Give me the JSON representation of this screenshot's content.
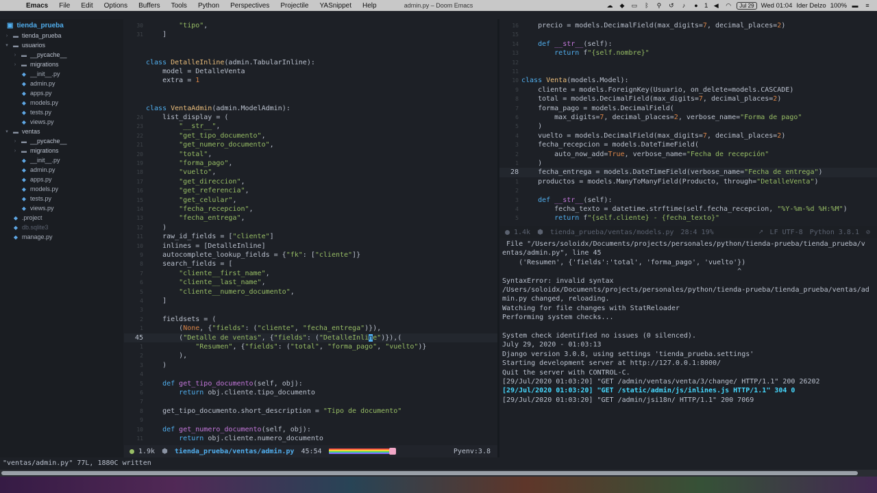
{
  "menubar": {
    "app": "Emacs",
    "items": [
      "File",
      "Edit",
      "Options",
      "Buffers",
      "Tools",
      "Python",
      "Perspectives",
      "Projectile",
      "YASnippet",
      "Help"
    ],
    "window_title": "admin.py – Doom Emacs",
    "date_badge": "Jul 29",
    "clock": "Wed 01:04",
    "user": "Ider Delzo",
    "battery": "100%",
    "notif_count": "1"
  },
  "sidebar": {
    "root": "tienda_prueba",
    "items": [
      {
        "label": "tienda_prueba",
        "kind": "dir",
        "open": false,
        "indent": 1
      },
      {
        "label": "usuarios",
        "kind": "dir",
        "open": true,
        "indent": 1
      },
      {
        "label": "__pycache__",
        "kind": "dir",
        "open": false,
        "indent": 2
      },
      {
        "label": "migrations",
        "kind": "dir",
        "open": false,
        "indent": 2
      },
      {
        "label": "__init__.py",
        "kind": "file",
        "indent": 2
      },
      {
        "label": "admin.py",
        "kind": "file",
        "indent": 2
      },
      {
        "label": "apps.py",
        "kind": "file",
        "indent": 2
      },
      {
        "label": "models.py",
        "kind": "file",
        "indent": 2
      },
      {
        "label": "tests.py",
        "kind": "file",
        "indent": 2
      },
      {
        "label": "views.py",
        "kind": "file",
        "indent": 2
      },
      {
        "label": "ventas",
        "kind": "dir",
        "open": true,
        "indent": 1
      },
      {
        "label": "__pycache__",
        "kind": "dir",
        "open": false,
        "indent": 2
      },
      {
        "label": "migrations",
        "kind": "dir",
        "open": false,
        "indent": 2
      },
      {
        "label": "__init__.py",
        "kind": "file",
        "indent": 2
      },
      {
        "label": "admin.py",
        "kind": "file",
        "indent": 2
      },
      {
        "label": "apps.py",
        "kind": "file",
        "indent": 2
      },
      {
        "label": "models.py",
        "kind": "file",
        "indent": 2
      },
      {
        "label": "tests.py",
        "kind": "file",
        "indent": 2
      },
      {
        "label": "views.py",
        "kind": "file",
        "indent": 2
      },
      {
        "label": ".project",
        "kind": "file",
        "indent": 1
      },
      {
        "label": "db.sqlite3",
        "kind": "file",
        "indent": 1,
        "dim": true
      },
      {
        "label": "manage.py",
        "kind": "file",
        "indent": 1
      }
    ]
  },
  "left_editor": {
    "lines": [
      {
        "n": "30",
        "t": [
          [
            "str",
            "        \"tipo\""
          ],
          [
            "pl",
            ","
          ]
        ]
      },
      {
        "n": "31",
        "t": [
          [
            "pl",
            "    ]"
          ]
        ]
      },
      {
        "n": "",
        "t": []
      },
      {
        "n": "",
        "t": []
      },
      {
        "n": "",
        "t": [
          [
            "kw",
            "class "
          ],
          [
            "cls",
            "DetalleInline"
          ],
          [
            "pl",
            "(admin.TabularInline):"
          ]
        ]
      },
      {
        "n": "",
        "t": [
          [
            "pl",
            "    model = DetalleVenta"
          ]
        ]
      },
      {
        "n": "",
        "t": [
          [
            "pl",
            "    extra = "
          ],
          [
            "num",
            "1"
          ]
        ]
      },
      {
        "n": "",
        "t": []
      },
      {
        "n": "",
        "t": []
      },
      {
        "n": "",
        "t": [
          [
            "kw",
            "class "
          ],
          [
            "cls",
            "VentaAdmin"
          ],
          [
            "pl",
            "(admin.ModelAdmin):"
          ]
        ]
      },
      {
        "n": "24",
        "t": [
          [
            "pl",
            "    list_display = ("
          ]
        ]
      },
      {
        "n": "23",
        "t": [
          [
            "str",
            "        \"__str__\""
          ],
          [
            "pl",
            ","
          ]
        ]
      },
      {
        "n": "22",
        "t": [
          [
            "str",
            "        \"get_tipo_documento\""
          ],
          [
            "pl",
            ","
          ]
        ]
      },
      {
        "n": "21",
        "t": [
          [
            "str",
            "        \"get_numero_documento\""
          ],
          [
            "pl",
            ","
          ]
        ]
      },
      {
        "n": "20",
        "t": [
          [
            "str",
            "        \"total\""
          ],
          [
            "pl",
            ","
          ]
        ]
      },
      {
        "n": "19",
        "t": [
          [
            "str",
            "        \"forma_pago\""
          ],
          [
            "pl",
            ","
          ]
        ]
      },
      {
        "n": "18",
        "t": [
          [
            "str",
            "        \"vuelto\""
          ],
          [
            "pl",
            ","
          ]
        ]
      },
      {
        "n": "17",
        "t": [
          [
            "str",
            "        \"get_direccion\""
          ],
          [
            "pl",
            ","
          ]
        ]
      },
      {
        "n": "16",
        "t": [
          [
            "str",
            "        \"get_referencia\""
          ],
          [
            "pl",
            ","
          ]
        ]
      },
      {
        "n": "15",
        "t": [
          [
            "str",
            "        \"get_celular\""
          ],
          [
            "pl",
            ","
          ]
        ]
      },
      {
        "n": "14",
        "t": [
          [
            "str",
            "        \"fecha_recepcion\""
          ],
          [
            "pl",
            ","
          ]
        ]
      },
      {
        "n": "13",
        "t": [
          [
            "str",
            "        \"fecha_entrega\""
          ],
          [
            "pl",
            ","
          ]
        ]
      },
      {
        "n": "12",
        "t": [
          [
            "pl",
            "    )"
          ]
        ]
      },
      {
        "n": "11",
        "t": [
          [
            "pl",
            "    raw_id_fields = ["
          ],
          [
            "str",
            "\"cliente\""
          ],
          [
            "pl",
            "]"
          ]
        ]
      },
      {
        "n": "10",
        "t": [
          [
            "pl",
            "    inlines = [DetalleInline]"
          ]
        ]
      },
      {
        "n": "9",
        "t": [
          [
            "pl",
            "    autocomplete_lookup_fields = {"
          ],
          [
            "str",
            "\"fk\""
          ],
          [
            "pl",
            ": ["
          ],
          [
            "str",
            "\"cliente\""
          ],
          [
            "pl",
            "]}"
          ]
        ]
      },
      {
        "n": "8",
        "t": [
          [
            "pl",
            "    search_fields = ["
          ]
        ]
      },
      {
        "n": "7",
        "t": [
          [
            "str",
            "        \"cliente__first_name\""
          ],
          [
            "pl",
            ","
          ]
        ]
      },
      {
        "n": "6",
        "t": [
          [
            "str",
            "        \"cliente__last_name\""
          ],
          [
            "pl",
            ","
          ]
        ]
      },
      {
        "n": "5",
        "t": [
          [
            "str",
            "        \"cliente__numero_documento\""
          ],
          [
            "pl",
            ","
          ]
        ]
      },
      {
        "n": "4",
        "t": [
          [
            "pl",
            "    ]"
          ]
        ]
      },
      {
        "n": "3",
        "t": []
      },
      {
        "n": "2",
        "t": [
          [
            "pl",
            "    fieldsets = ("
          ]
        ]
      },
      {
        "n": "1",
        "t": [
          [
            "pl",
            "        ("
          ],
          [
            "num",
            "None"
          ],
          [
            "pl",
            ", {"
          ],
          [
            "str",
            "\"fields\""
          ],
          [
            "pl",
            ": ("
          ],
          [
            "str",
            "\"cliente\""
          ],
          [
            "pl",
            ", "
          ],
          [
            "str",
            "\"fecha_entrega\""
          ],
          [
            "pl",
            ")}),"
          ]
        ]
      },
      {
        "n": "45",
        "cur": true,
        "t": [
          [
            "pl",
            "        ("
          ],
          [
            "str",
            "\"Detalle de ventas\""
          ],
          [
            "pl",
            ", {"
          ],
          [
            "str",
            "\"fields\""
          ],
          [
            "pl",
            ": ("
          ],
          [
            "str",
            "\"DetalleInli"
          ],
          [
            "cur",
            "n"
          ],
          [
            "str",
            "e\""
          ],
          [
            "pl",
            ")}),("
          ]
        ]
      },
      {
        "n": "1",
        "t": [
          [
            "str",
            "            \"Resumen\""
          ],
          [
            "pl",
            ", {"
          ],
          [
            "str",
            "\"fields\""
          ],
          [
            "pl",
            ": ("
          ],
          [
            "str",
            "\"total\""
          ],
          [
            "pl",
            ", "
          ],
          [
            "str",
            "\"forma_pago\""
          ],
          [
            "pl",
            ", "
          ],
          [
            "str",
            "\"vuelto\""
          ],
          [
            "pl",
            ")}"
          ]
        ]
      },
      {
        "n": "2",
        "t": [
          [
            "pl",
            "        ),"
          ]
        ]
      },
      {
        "n": "3",
        "t": [
          [
            "pl",
            "    )"
          ]
        ]
      },
      {
        "n": "4",
        "t": []
      },
      {
        "n": "5",
        "t": [
          [
            "kw",
            "    def "
          ],
          [
            "fn",
            "get_tipo_documento"
          ],
          [
            "pl",
            "(self, obj):"
          ]
        ]
      },
      {
        "n": "6",
        "t": [
          [
            "kw",
            "        return "
          ],
          [
            "pl",
            "obj.cliente.tipo_documento"
          ]
        ]
      },
      {
        "n": "7",
        "t": []
      },
      {
        "n": "8",
        "t": [
          [
            "pl",
            "    get_tipo_documento.short_description = "
          ],
          [
            "str",
            "\"Tipo de documento\""
          ]
        ]
      },
      {
        "n": "9",
        "t": []
      },
      {
        "n": "10",
        "t": [
          [
            "kw",
            "    def "
          ],
          [
            "fn",
            "get_numero_documento"
          ],
          [
            "pl",
            "(self, obj):"
          ]
        ]
      },
      {
        "n": "11",
        "t": [
          [
            "kw",
            "        return "
          ],
          [
            "pl",
            "obj.cliente.numero_documento"
          ]
        ]
      }
    ]
  },
  "right_editor": {
    "lines": [
      {
        "n": "16",
        "t": [
          [
            "pl",
            "    precio = models.DecimalField(max_digits="
          ],
          [
            "num",
            "7"
          ],
          [
            "pl",
            ", decimal_places="
          ],
          [
            "num",
            "2"
          ],
          [
            "pl",
            ")"
          ]
        ]
      },
      {
        "n": "15",
        "t": []
      },
      {
        "n": "14",
        "t": [
          [
            "kw",
            "    def "
          ],
          [
            "fn",
            "__str__"
          ],
          [
            "pl",
            "(self):"
          ]
        ]
      },
      {
        "n": "13",
        "t": [
          [
            "kw",
            "        return "
          ],
          [
            "pl",
            "f"
          ],
          [
            "str",
            "\"{self.nombre}\""
          ]
        ]
      },
      {
        "n": "12",
        "t": []
      },
      {
        "n": "11",
        "t": []
      },
      {
        "n": "10",
        "t": [
          [
            "kw",
            "class "
          ],
          [
            "cls",
            "Venta"
          ],
          [
            "pl",
            "(models.Model):"
          ]
        ]
      },
      {
        "n": "9",
        "t": [
          [
            "pl",
            "    cliente = models.ForeignKey(Usuario, on_delete=models.CASCADE)"
          ]
        ]
      },
      {
        "n": "8",
        "t": [
          [
            "pl",
            "    total = models.DecimalField(max_digits="
          ],
          [
            "num",
            "7"
          ],
          [
            "pl",
            ", decimal_places="
          ],
          [
            "num",
            "2"
          ],
          [
            "pl",
            ")"
          ]
        ]
      },
      {
        "n": "7",
        "t": [
          [
            "pl",
            "    forma_pago = models.DecimalField("
          ]
        ]
      },
      {
        "n": "6",
        "t": [
          [
            "pl",
            "        max_digits="
          ],
          [
            "num",
            "7"
          ],
          [
            "pl",
            ", decimal_places="
          ],
          [
            "num",
            "2"
          ],
          [
            "pl",
            ", verbose_name="
          ],
          [
            "str",
            "\"Forma de pago\""
          ]
        ]
      },
      {
        "n": "5",
        "t": [
          [
            "pl",
            "    )"
          ]
        ]
      },
      {
        "n": "4",
        "t": [
          [
            "pl",
            "    vuelto = models.DecimalField(max_digits="
          ],
          [
            "num",
            "7"
          ],
          [
            "pl",
            ", decimal_places="
          ],
          [
            "num",
            "2"
          ],
          [
            "pl",
            ")"
          ]
        ]
      },
      {
        "n": "3",
        "t": [
          [
            "pl",
            "    fecha_recepcion = models.DateTimeField("
          ]
        ]
      },
      {
        "n": "2",
        "t": [
          [
            "pl",
            "        auto_now_add="
          ],
          [
            "num",
            "True"
          ],
          [
            "pl",
            ", verbose_name="
          ],
          [
            "str",
            "\"Fecha de recepción\""
          ]
        ]
      },
      {
        "n": "1",
        "t": [
          [
            "pl",
            "    )"
          ]
        ]
      },
      {
        "n": "28",
        "cur": true,
        "t": [
          [
            "pl",
            "    fecha_entrega = models.DateTimeField(verbose_name="
          ],
          [
            "str",
            "\"Fecha de entrega\""
          ],
          [
            "pl",
            ")"
          ]
        ]
      },
      {
        "n": "1",
        "t": [
          [
            "pl",
            "    productos = models.ManyToManyField(Producto, through="
          ],
          [
            "str",
            "\"DetalleVenta\""
          ],
          [
            "pl",
            ")"
          ]
        ]
      },
      {
        "n": "2",
        "t": []
      },
      {
        "n": "3",
        "t": [
          [
            "kw",
            "    def "
          ],
          [
            "fn",
            "__str__"
          ],
          [
            "pl",
            "(self):"
          ]
        ]
      },
      {
        "n": "4",
        "t": [
          [
            "pl",
            "        fecha_texto = datetime.strftime(self.fecha_recepcion, "
          ],
          [
            "str",
            "\"%Y-%m-%d %H:%M\""
          ],
          [
            "pl",
            ")"
          ]
        ]
      },
      {
        "n": "5",
        "t": [
          [
            "kw",
            "        return "
          ],
          [
            "pl",
            "f"
          ],
          [
            "str",
            "\"{self.cliente} - {fecha_texto}\""
          ]
        ]
      }
    ]
  },
  "right_modeline": {
    "size": "1.4k",
    "file": "tienda_prueba/ventas/models.py",
    "pos": "28:4 19%",
    "encoding": "LF UTF-8",
    "lang": "Python 3.8.1"
  },
  "left_modeline": {
    "size": "1.9k",
    "file": "tienda_prueba/ventas/admin.py",
    "pos": "45:54",
    "env": "Pyenv:3.8"
  },
  "terminal": {
    "lines": [
      {
        "t": " File \"/Users/soloidx/Documents/projects/personales/python/tienda-prueba/tienda_prueba/v"
      },
      {
        "t": "entas/admin.py\", line 45"
      },
      {
        "t": "    ('Resumen', {'fields':'total', 'forma_pago', 'vuelto'})"
      },
      {
        "t": "                                                         ^"
      },
      {
        "t": "SyntaxError: invalid syntax"
      },
      {
        "t": "/Users/soloidx/Documents/projects/personales/python/tienda-prueba/tienda_prueba/ventas/ad"
      },
      {
        "t": "min.py changed, reloading."
      },
      {
        "t": "Watching for file changes with StatReloader"
      },
      {
        "t": "Performing system checks..."
      },
      {
        "t": ""
      },
      {
        "t": "System check identified no issues (0 silenced)."
      },
      {
        "t": "July 29, 2020 - 01:03:13"
      },
      {
        "t": "Django version 3.0.8, using settings 'tienda_prueba.settings'"
      },
      {
        "t": "Starting development server at http://127.0.0.1:8000/"
      },
      {
        "t": "Quit the server with CONTROL-C."
      },
      {
        "t": "[29/Jul/2020 01:03:20] \"GET /admin/ventas/venta/3/change/ HTTP/1.1\" 200 26202"
      },
      {
        "t": "[29/Jul/2020 01:03:20] \"GET /static/admin/js/inlines.js HTTP/1.1\" 304 0",
        "hl": true
      },
      {
        "t": "[29/Jul/2020 01:03:20] \"GET /admin/jsi18n/ HTTP/1.1\" 200 7069"
      }
    ]
  },
  "echo_area": "\"ventas/admin.py\" 77L, 1880C written",
  "colors": {
    "accent": "#51afef",
    "active_dot": "#98be65",
    "bg": "#1d2026"
  }
}
